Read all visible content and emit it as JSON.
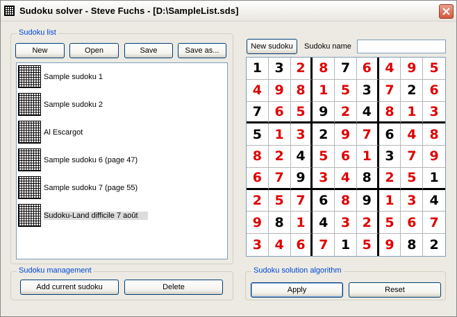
{
  "window": {
    "title": "Sudoku solver - Steve Fuchs - [D:\\SampleList.sds]"
  },
  "sudoku_list": {
    "group_label": "Sudoku list",
    "buttons": {
      "new": "New",
      "open": "Open",
      "save": "Save",
      "save_as": "Save as..."
    },
    "items": [
      {
        "label": "Sample sudoku 1"
      },
      {
        "label": "Sample sudoku 2"
      },
      {
        "label": "Al Escargot"
      },
      {
        "label": "Sample sudoku 6 (page 47)"
      },
      {
        "label": "Sample sudoku 7 (page 55)"
      },
      {
        "label": "Sudoku-Land difficile 7 août",
        "selected": true
      }
    ]
  },
  "sudoku_management": {
    "group_label": "Sudoku management",
    "add_label": "Add current sudoku",
    "delete_label": "Delete"
  },
  "editor": {
    "new_sudoku_label": "New sudoku",
    "name_label": "Sudoku name",
    "name_value": ""
  },
  "solution_algorithm": {
    "group_label": "Sudoku solution algorithm",
    "apply_label": "Apply",
    "reset_label": "Reset"
  },
  "colors": {
    "given": "#000000",
    "solved": "#e00000",
    "group_label": "#0046d5"
  },
  "grid": {
    "values": [
      [
        1,
        3,
        2,
        8,
        7,
        6,
        4,
        9,
        5
      ],
      [
        4,
        9,
        8,
        1,
        5,
        3,
        7,
        2,
        6
      ],
      [
        7,
        6,
        5,
        9,
        2,
        4,
        8,
        1,
        3
      ],
      [
        5,
        1,
        3,
        2,
        9,
        7,
        6,
        4,
        8
      ],
      [
        8,
        2,
        4,
        5,
        6,
        1,
        3,
        7,
        9
      ],
      [
        6,
        7,
        9,
        3,
        4,
        8,
        2,
        5,
        1
      ],
      [
        2,
        5,
        7,
        6,
        8,
        9,
        1,
        3,
        4
      ],
      [
        9,
        8,
        1,
        4,
        3,
        2,
        5,
        6,
        7
      ],
      [
        3,
        4,
        6,
        7,
        1,
        5,
        9,
        8,
        2
      ]
    ],
    "given": [
      [
        1,
        1,
        0,
        0,
        1,
        0,
        0,
        0,
        0
      ],
      [
        0,
        0,
        0,
        0,
        0,
        1,
        0,
        1,
        0
      ],
      [
        1,
        0,
        0,
        1,
        0,
        1,
        0,
        0,
        0
      ],
      [
        1,
        0,
        0,
        1,
        0,
        0,
        1,
        0,
        0
      ],
      [
        0,
        0,
        1,
        0,
        0,
        0,
        1,
        0,
        0
      ],
      [
        0,
        0,
        1,
        0,
        0,
        1,
        0,
        0,
        1
      ],
      [
        0,
        0,
        0,
        1,
        0,
        1,
        0,
        0,
        1
      ],
      [
        0,
        1,
        0,
        1,
        0,
        0,
        0,
        0,
        0
      ],
      [
        0,
        0,
        0,
        0,
        1,
        0,
        0,
        1,
        1
      ]
    ]
  }
}
